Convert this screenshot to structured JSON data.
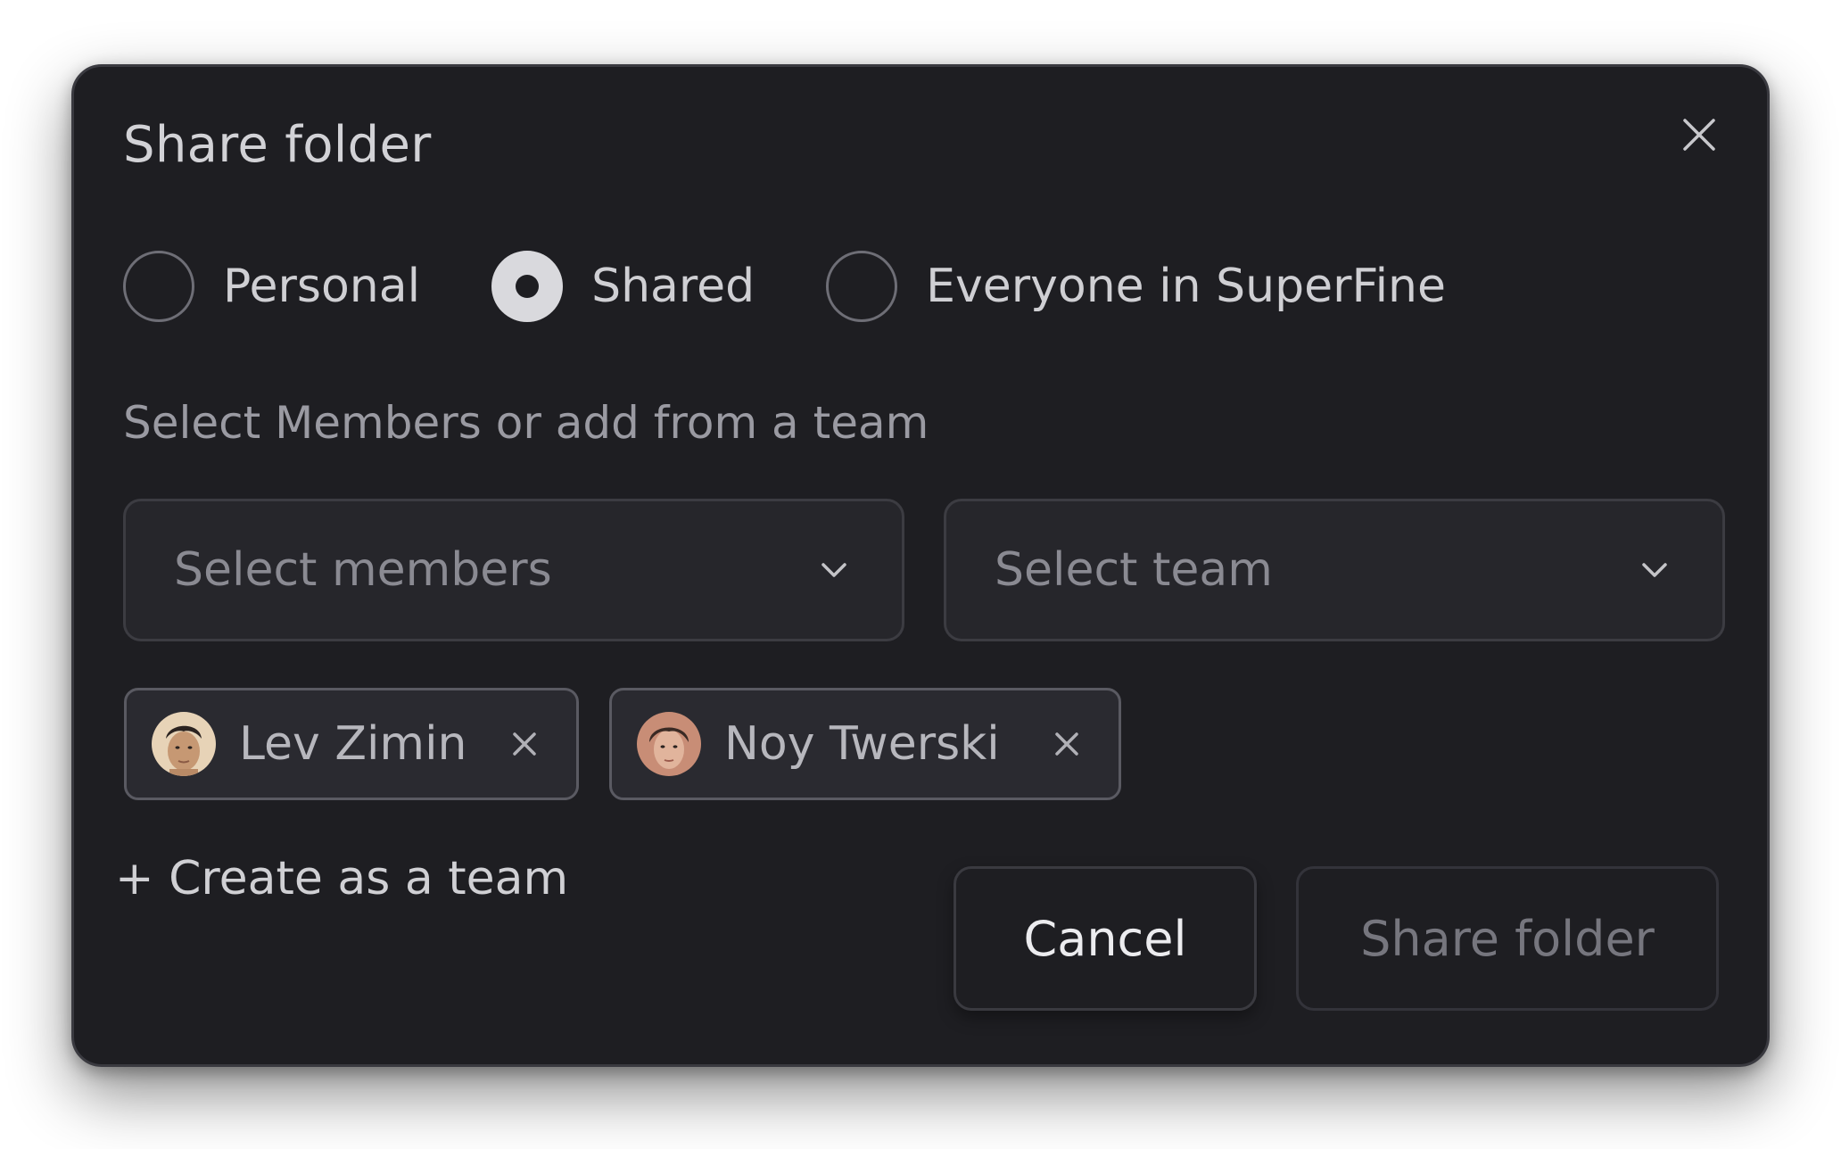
{
  "dialog": {
    "title": "Share folder",
    "close_icon": "close-icon"
  },
  "visibility": {
    "options": [
      {
        "label": "Personal",
        "selected": false
      },
      {
        "label": "Shared",
        "selected": true
      },
      {
        "label": "Everyone in SuperFine",
        "selected": false
      }
    ]
  },
  "members_section": {
    "label": "Select Members or add from a team",
    "members_select": {
      "placeholder": "Select members",
      "icon": "chevron-down-icon"
    },
    "team_select": {
      "placeholder": "Select team",
      "icon": "chevron-down-icon"
    }
  },
  "selected_members": [
    {
      "name": "Lev Zimin",
      "avatar": "avatar-photo",
      "remove_icon": "close-icon"
    },
    {
      "name": "Noy Twerski",
      "avatar": "avatar-photo",
      "remove_icon": "close-icon"
    }
  ],
  "create_team": {
    "label": "+ Create as a team"
  },
  "actions": {
    "cancel_label": "Cancel",
    "share_label": "Share folder"
  },
  "colors": {
    "dialog_background": "#1e1e22",
    "text_primary": "#d2d2d6",
    "text_muted": "#8a8a92",
    "radio_selected": "#d9d9dd"
  }
}
